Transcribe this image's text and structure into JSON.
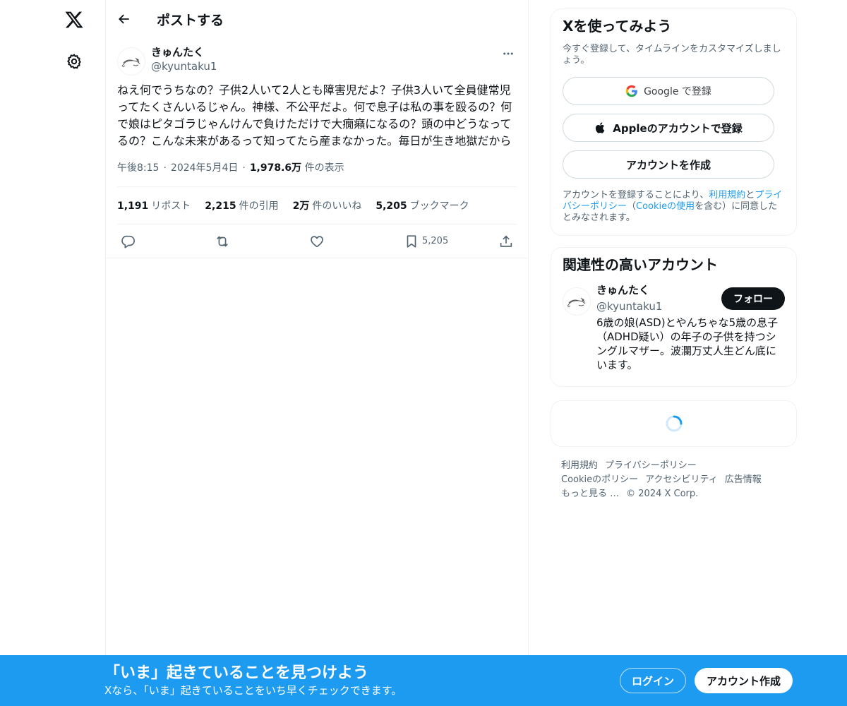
{
  "header": {
    "title": "ポストする"
  },
  "post": {
    "author_name": "きゅんたく",
    "author_handle": "@kyuntaku1",
    "text": "ねえ何でうちなの？子供2人いて2人とも障害児だよ？子供3人いて全員健常児ってたくさんいるじゃん。神様、不公平だよ。何で息子は私の事を殴るの？何で娘はピタゴラじゃんけんで負けただけで大癇癪になるの？頭の中どうなってるの？こんな未来があるって知ってたら産まなかった。毎日が生き地獄だから",
    "time": "午後8:15",
    "date": "2024年5月4日",
    "views_count": "1,978.6万",
    "views_label": "件の表示",
    "stats": {
      "reposts_count": "1,191",
      "reposts_label": "リポスト",
      "quotes_count": "2,215",
      "quotes_label": "件の引用",
      "likes_count": "2万",
      "likes_label": "件のいいね",
      "bookmarks_count": "5,205",
      "bookmarks_label": "ブックマーク"
    },
    "bookmark_action_count": "5,205"
  },
  "signup": {
    "title": "Xを使ってみよう",
    "subtitle": "今すぐ登録して、タイムラインをカスタマイズしましょう。",
    "google_label": "Google で登録",
    "apple_label": "Appleのアカウントで登録",
    "create_label": "アカウントを作成",
    "legal_prefix": "アカウントを登録することにより、",
    "legal_terms": "利用規約",
    "legal_and": "と",
    "legal_privacy": "プライバシーポリシー",
    "legal_open": "（",
    "legal_cookie": "Cookieの使用",
    "legal_suffix": "を含む）に同意したとみなされます。"
  },
  "related": {
    "title": "関連性の高いアカウント",
    "name": "きゅんたく",
    "handle": "@kyuntaku1",
    "bio": "6歳の娘(ASD)とやんちゃな5歳の息子（ADHD疑い）の年子の子供を持つシングルマザー。波瀾万丈人生どん底にいます。",
    "follow_label": "フォロー"
  },
  "footer": {
    "terms": "利用規約",
    "privacy": "プライバシーポリシー",
    "cookie": "Cookieのポリシー",
    "accessibility": "アクセシビリティ",
    "ads": "広告情報",
    "more": "もっと見る …",
    "copyright": "© 2024 X Corp."
  },
  "bottom_bar": {
    "title": "「いま」起きていることを見つけよう",
    "subtitle": "Xなら、「いま」起きていることをいち早くチェックできます。",
    "login_label": "ログイン",
    "signup_label": "アカウント作成"
  },
  "colors": {
    "accent": "#1d9bf0",
    "text": "#0f1419",
    "secondary": "#536471",
    "border": "#eff3f4"
  },
  "icons": [
    "x-logo-icon",
    "gear-icon",
    "back-arrow-icon",
    "more-icon",
    "reply-icon",
    "repost-icon",
    "like-icon",
    "bookmark-icon",
    "share-icon",
    "google-icon",
    "apple-icon",
    "spinner-icon"
  ]
}
